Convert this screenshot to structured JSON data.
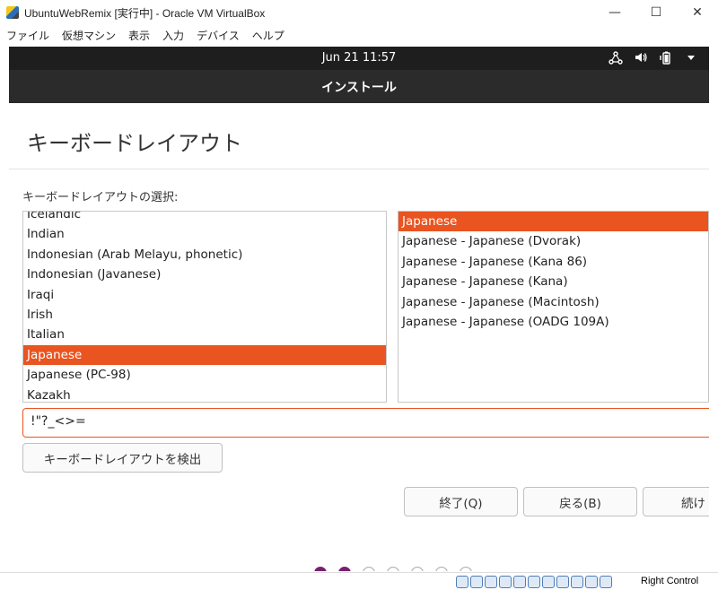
{
  "host_window": {
    "title": "UbuntuWebRemix [実行中] - Oracle VM VirtualBox",
    "menu": [
      "ファイル",
      "仮想マシン",
      "表示",
      "入力",
      "デバイス",
      "ヘルプ"
    ],
    "controls": {
      "minimize": "—",
      "maximize": "☐",
      "close": "✕"
    },
    "host_key": "Right Control"
  },
  "guest_topbar": {
    "clock": "Jun 21  11:57",
    "tray_icons": [
      "network-icon",
      "volume-icon",
      "battery-icon",
      "menu-arrow-icon"
    ]
  },
  "installer": {
    "header": "インストール",
    "page_title": "キーボードレイアウト",
    "select_label": "キーボードレイアウトの選択:",
    "layouts": [
      {
        "label": "Icelandic",
        "selected": false
      },
      {
        "label": "Indian",
        "selected": false
      },
      {
        "label": "Indonesian (Arab Melayu, phonetic)",
        "selected": false
      },
      {
        "label": "Indonesian (Javanese)",
        "selected": false
      },
      {
        "label": "Iraqi",
        "selected": false
      },
      {
        "label": "Irish",
        "selected": false
      },
      {
        "label": "Italian",
        "selected": false
      },
      {
        "label": "Japanese",
        "selected": true
      },
      {
        "label": "Japanese (PC-98)",
        "selected": false
      },
      {
        "label": "Kazakh",
        "selected": false
      }
    ],
    "variants": [
      {
        "label": "Japanese",
        "selected": true
      },
      {
        "label": "Japanese - Japanese (Dvorak)",
        "selected": false
      },
      {
        "label": "Japanese - Japanese (Kana 86)",
        "selected": false
      },
      {
        "label": "Japanese - Japanese (Kana)",
        "selected": false
      },
      {
        "label": "Japanese - Japanese (Macintosh)",
        "selected": false
      },
      {
        "label": "Japanese - Japanese (OADG 109A)",
        "selected": false
      }
    ],
    "test_input_value": "!\"?_<>=",
    "detect_button": "キーボードレイアウトを検出",
    "quit_button": "終了(Q)",
    "back_button": "戻る(B)",
    "continue_button": "続け",
    "progress": {
      "total_steps": 7,
      "completed_steps": 2
    }
  },
  "colors": {
    "accent": "#e95420",
    "progress_done": "#77216f"
  }
}
